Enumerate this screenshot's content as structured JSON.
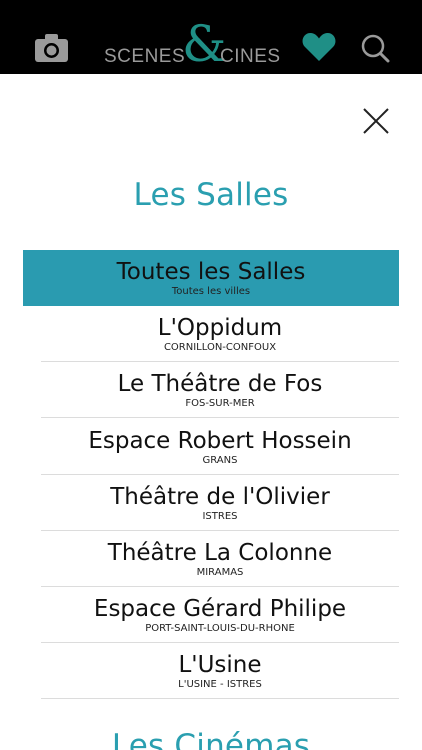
{
  "header": {
    "logo_left": "SCENES",
    "logo_amp": "&",
    "logo_right": "CINES",
    "icons": [
      "camera-icon",
      "heart-icon",
      "search-icon"
    ],
    "background": "#000000",
    "accent": "#1f8f86"
  },
  "salles": {
    "title": "Les Salles",
    "items": [
      {
        "name": "Toutes les Salles",
        "city": "Toutes les villes",
        "selected": true
      },
      {
        "name": "L'Oppidum",
        "city": "CORNILLON-CONFOUX"
      },
      {
        "name": "Le Théâtre de Fos",
        "city": "FOS-SUR-MER"
      },
      {
        "name": "Espace Robert Hossein",
        "city": "GRANS"
      },
      {
        "name": "Théâtre de l'Olivier",
        "city": "ISTRES"
      },
      {
        "name": "Théâtre La Colonne",
        "city": "MIRAMAS"
      },
      {
        "name": "Espace Gérard Philipe",
        "city": "PORT-SAINT-LOUIS-DU-RHONE"
      },
      {
        "name": "L'Usine",
        "city": "L'USINE - ISTRES"
      }
    ]
  },
  "cinemas": {
    "title": "Les Cinémas"
  },
  "colors": {
    "title": "#2a9fb0",
    "selected_bg": "#2a9bb0"
  }
}
